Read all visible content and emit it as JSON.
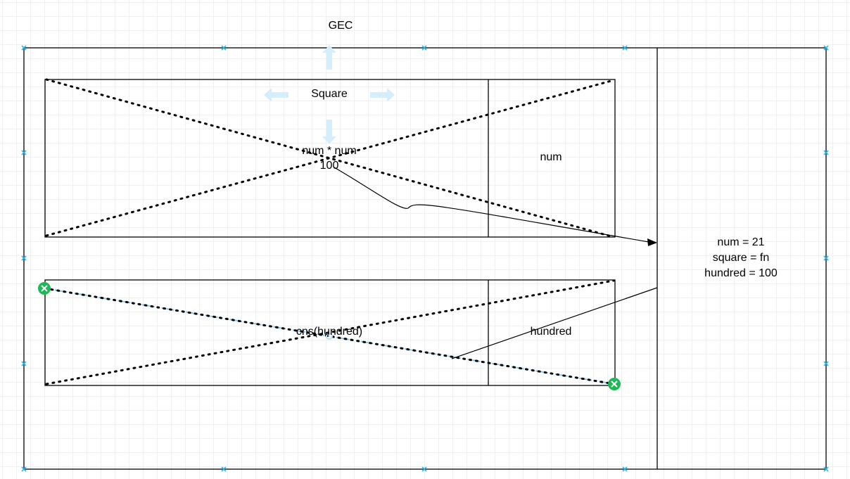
{
  "diagram": {
    "title": "GEC",
    "square_box": {
      "name": "Square",
      "body_line1": "num * num",
      "body_line2": "100",
      "param": "num"
    },
    "cns_box": {
      "call": "cns(hundred)",
      "param": "hundred"
    },
    "memory": {
      "line1": "num = 21",
      "line2": "square  = fn",
      "line3": "hundred =  100"
    },
    "colors": {
      "stroke": "#000000",
      "selection_handle": "#29b6f6",
      "move_arrow": "#d6eefb",
      "endpoint_handle": "#1db954"
    },
    "icons": [
      "move-up-arrow-icon",
      "move-left-arrow-icon",
      "move-right-arrow-icon",
      "move-down-arrow-icon",
      "selection-handle-icon",
      "endpoint-remove-icon"
    ]
  }
}
